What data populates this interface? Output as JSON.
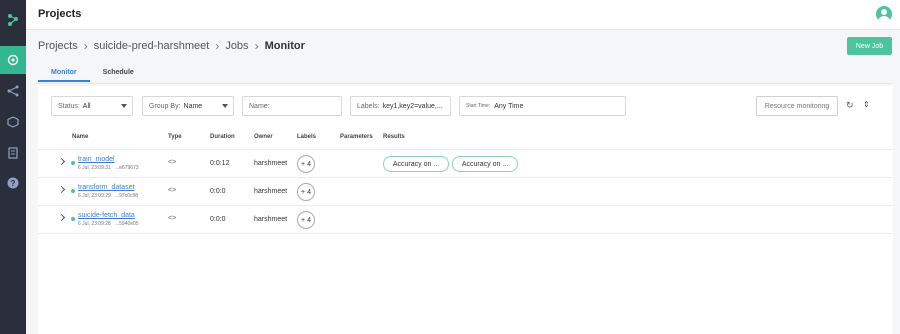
{
  "app": {
    "title": "Projects"
  },
  "breadcrumb": {
    "items": [
      "Projects",
      "suicide-pred-harshmeet",
      "Jobs",
      "Monitor"
    ],
    "separator": "›"
  },
  "header": {
    "new_job_label": "New Job"
  },
  "tabs": [
    {
      "label": "Monitor",
      "active": true
    },
    {
      "label": "Schedule",
      "active": false
    }
  ],
  "filters": {
    "status": {
      "label": "Status:",
      "value": "All"
    },
    "group_by": {
      "label": "Group By:",
      "value": "Name"
    },
    "name": {
      "placeholder": "Name:"
    },
    "labels": {
      "label": "Labels:",
      "value": "key1,key2=value,..."
    },
    "start_time": {
      "label": "Start Time:",
      "value": "Any Time"
    },
    "resource_monitoring_label": "Resource monitoring",
    "refresh_icon": "↻",
    "collapse_icon": "⇕"
  },
  "table": {
    "columns": [
      "Name",
      "Type",
      "Duration",
      "Owner",
      "Labels",
      "Parameters",
      "Results"
    ],
    "rows": [
      {
        "name": "train_model",
        "time": "6 Jul, 23:09:31",
        "uid": "...e679673",
        "type": "<>",
        "duration": "0:0:12",
        "owner": "harshmeet",
        "labels": "+ 4",
        "results": [
          "Accuracy on ...",
          "Accuracy on ..."
        ]
      },
      {
        "name": "transform_dataset",
        "time": "6 Jul, 23:09:29",
        "uid": "...97c0c98",
        "type": "<>",
        "duration": "0:0:0",
        "owner": "harshmeet",
        "labels": "+ 4",
        "results": []
      },
      {
        "name": "suicide-fetch_data",
        "time": "6 Jul, 23:09:28",
        "uid": "...5940e05",
        "type": "<>",
        "duration": "0:0:0",
        "owner": "harshmeet",
        "labels": "+ 4",
        "results": []
      }
    ]
  },
  "colors": {
    "accent": "#4cc49c",
    "sidebar": "#2b2e3b",
    "link": "#3b7fd6"
  }
}
